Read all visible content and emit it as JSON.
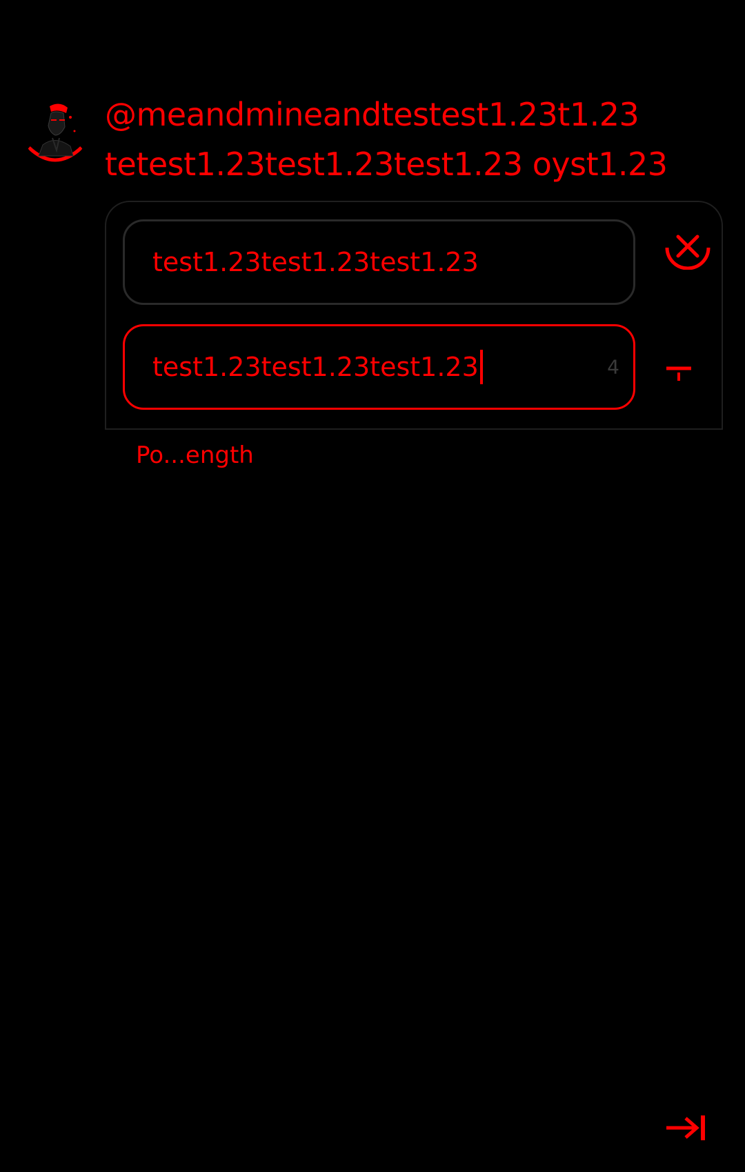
{
  "header": {
    "line1": "@meandmineandtestest1.23t1.23",
    "line2": "tetest1.23test1.23test1.23 oyst1.23"
  },
  "poll": {
    "options": [
      {
        "value": "test1.23test1.23test1.23"
      },
      {
        "value": "test1.23test1.23test1.23",
        "char_count": "4"
      }
    ],
    "length_label": "Po...ength"
  },
  "icons": {
    "avatar": "avatar",
    "remove": "close-circle-icon",
    "add": "plus-icon",
    "send": "arrow-to-right-icon"
  },
  "colors": {
    "accent": "#ff0000",
    "background": "#000000",
    "border": "#2a2a2a"
  }
}
